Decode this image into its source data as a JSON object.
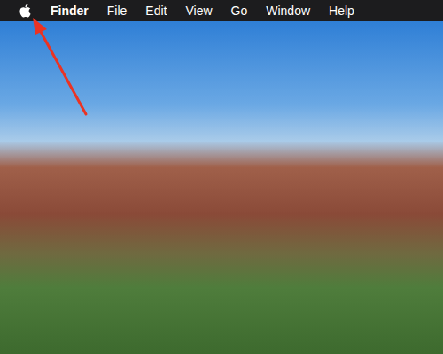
{
  "menu_bar": {
    "app_name": "Finder",
    "items": [
      "File",
      "Edit",
      "View",
      "Go",
      "Window",
      "Help"
    ]
  }
}
